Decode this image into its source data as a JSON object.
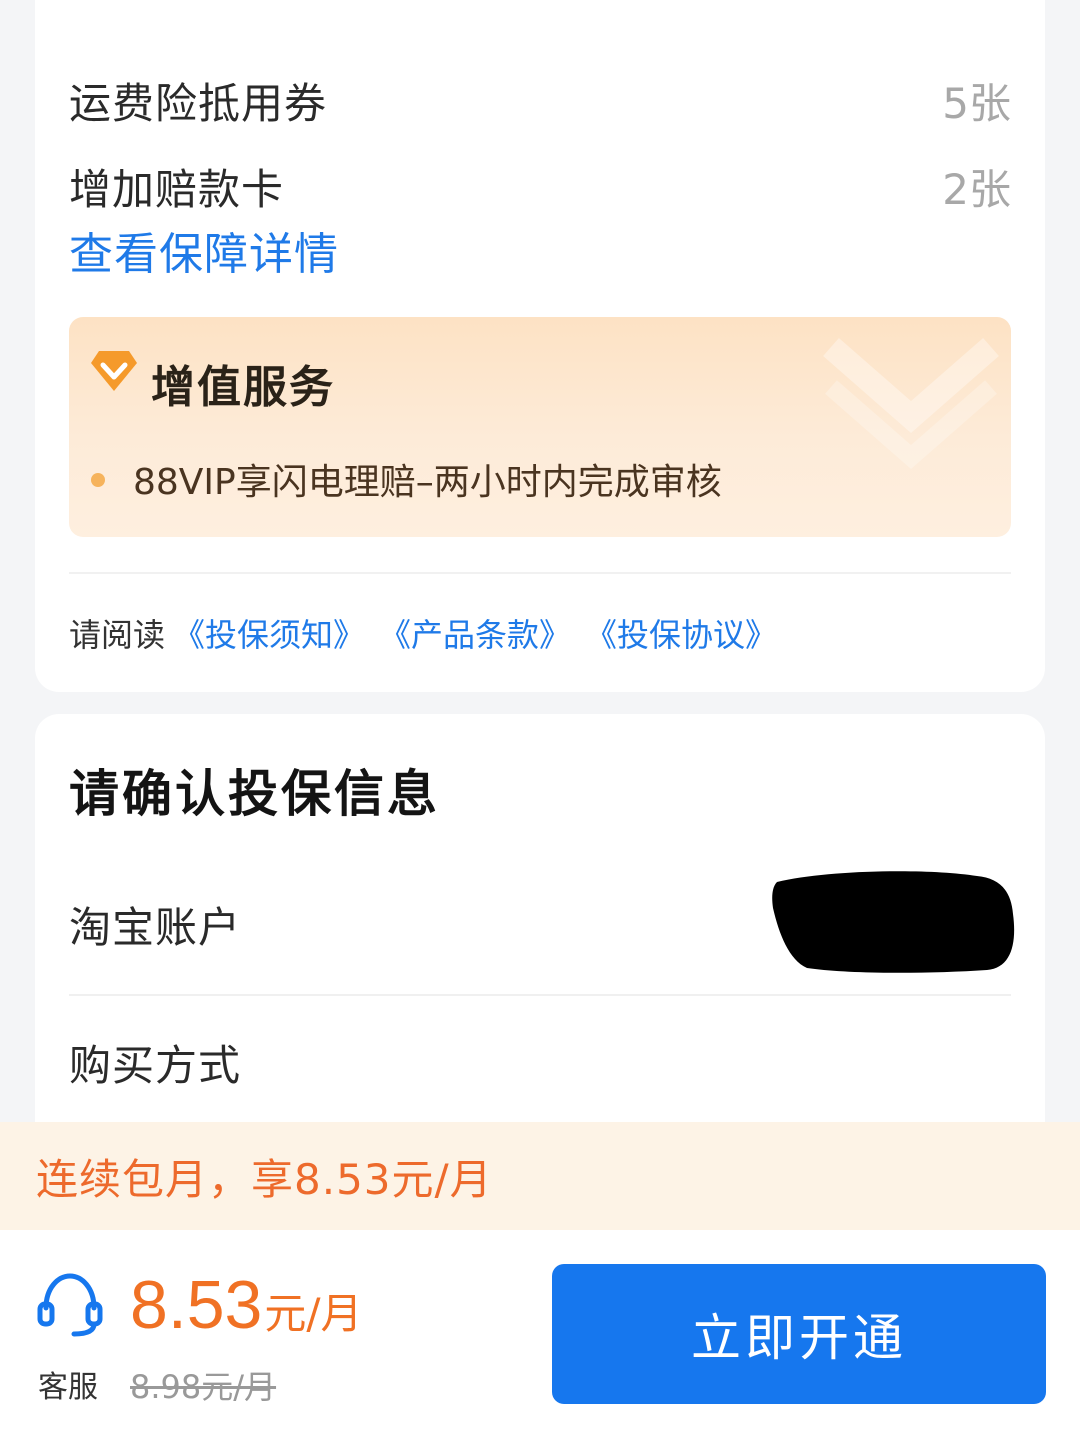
{
  "coverage": {
    "items": [
      {
        "label": "运费险抵用券",
        "value": "5张"
      },
      {
        "label": "增加赔款卡",
        "value": "2张"
      }
    ],
    "details_link": "查看保障详情"
  },
  "value_added": {
    "title": "增值服务",
    "bullet": "88VIP享闪电理赔–两小时内完成审核"
  },
  "reading": {
    "prefix": "请阅读",
    "links": [
      "《投保须知》",
      "《产品条款》",
      "《投保协议》"
    ]
  },
  "confirm": {
    "title": "请确认投保信息",
    "account_label": "淘宝账户",
    "purchase_label": "购买方式"
  },
  "promo": {
    "text": "连续包月，享8.53元/月"
  },
  "bottom": {
    "service_label": "客服",
    "price": "8.53",
    "price_unit": "元/月",
    "old_price": "8.98元/月",
    "button_label": "立即开通"
  },
  "colors": {
    "accent_blue": "#1677ee",
    "link_blue": "#1f7ae8",
    "price_orange": "#f07124",
    "promo_bg": "#fdf3e6"
  },
  "icons": [
    "diamond-icon",
    "customer-service-headset-icon"
  ]
}
